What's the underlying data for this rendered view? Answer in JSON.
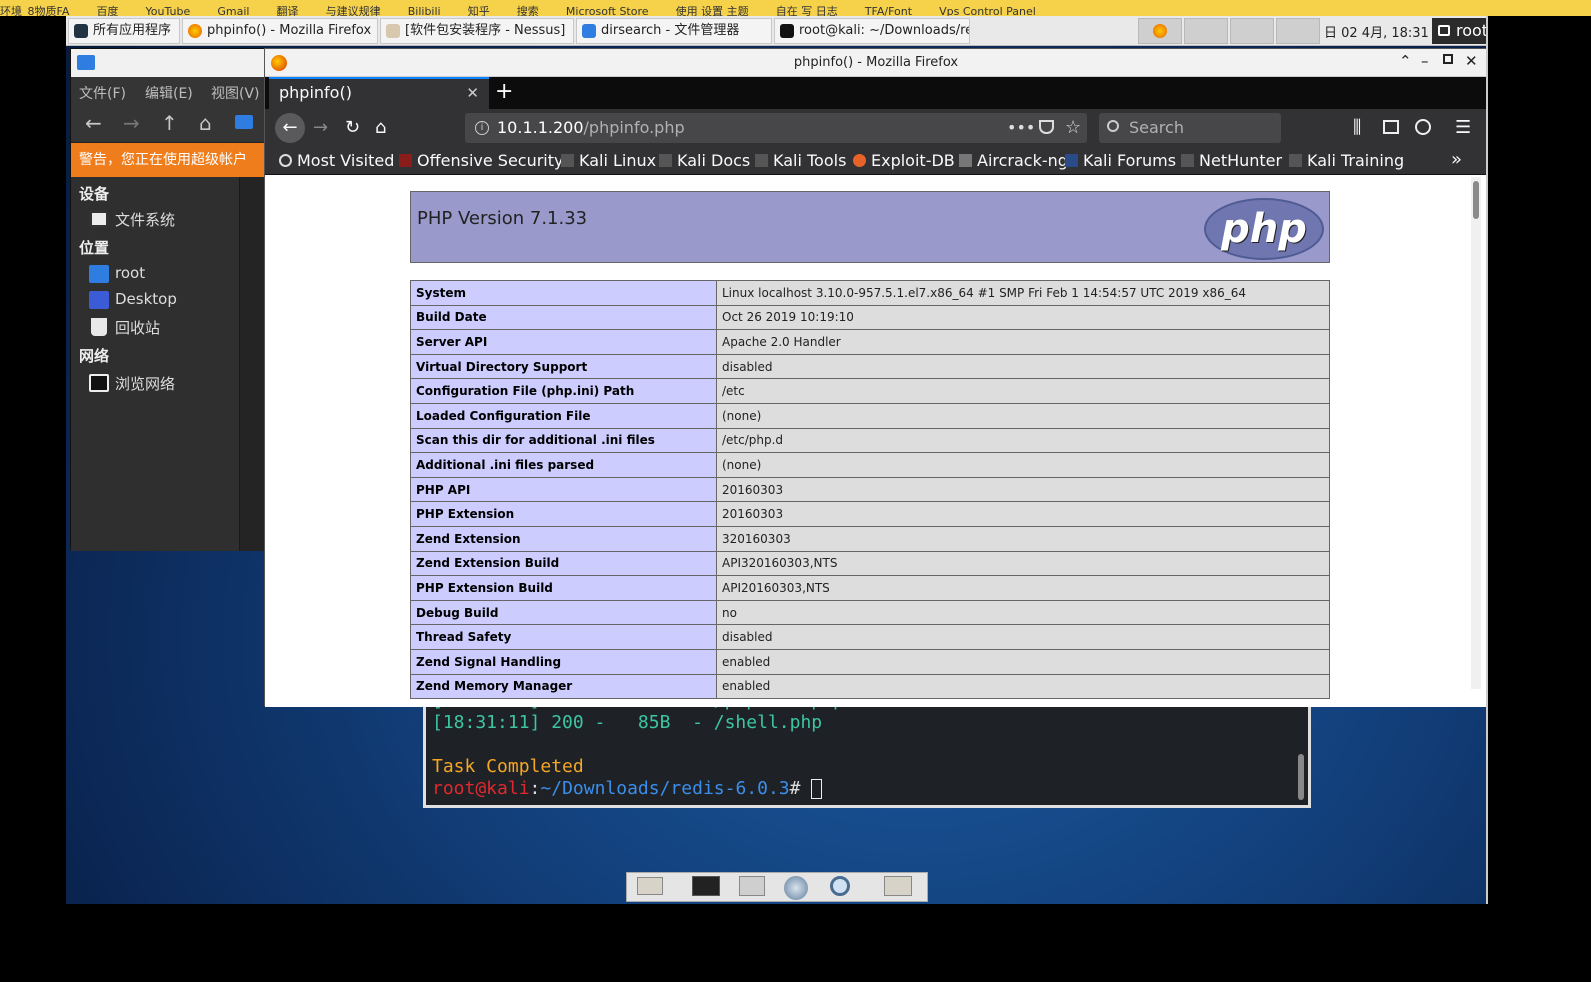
{
  "host_bar": {
    "items": [
      "环境_8物质FA",
      "百度",
      "YouTube",
      "Gmail",
      "翻译",
      "与建议规律",
      "Bilibili",
      "知乎",
      "搜索",
      "Microsoft Store",
      "使用 设置 主题",
      "自在 写 日志",
      "TFA/Font",
      "Vps Control Panel"
    ]
  },
  "taskbar": {
    "apps_label": "所有应用程序",
    "windows": [
      {
        "label": "phpinfo() - Mozilla Firefox",
        "icon": "firefox-icon"
      },
      {
        "label": "[软件包安装程序 - Nessus]",
        "icon": "package-icon"
      },
      {
        "label": "dirsearch - 文件管理器",
        "icon": "folder-icon"
      },
      {
        "label": "root@kali: ~/Downloads/re…",
        "icon": "terminal-icon"
      }
    ],
    "clock": "日 02 4月, 18:31",
    "user": "root"
  },
  "file_manager": {
    "menu": [
      "文件(F)",
      "编辑(E)",
      "视图(V)"
    ],
    "warning": "警告，您正在使用超级帐户",
    "sections": [
      {
        "heading": "设备",
        "items": [
          {
            "label": "文件系统",
            "icon": "drive-icon"
          }
        ]
      },
      {
        "heading": "位置",
        "items": [
          {
            "label": "root",
            "icon": "home-folder-icon"
          },
          {
            "label": "Desktop",
            "icon": "desktop-folder-icon"
          },
          {
            "label": "回收站",
            "icon": "trash-icon"
          }
        ]
      },
      {
        "heading": "网络",
        "items": [
          {
            "label": "浏览网络",
            "icon": "network-icon"
          }
        ]
      }
    ]
  },
  "firefox": {
    "window_title": "phpinfo() - Mozilla Firefox",
    "tab_title": "phpinfo()",
    "url_host": "10.1.1.200",
    "url_path": "/phpinfo.php",
    "search_placeholder": "Search",
    "bookmarks": [
      "Most Visited",
      "Offensive Security",
      "Kali Linux",
      "Kali Docs",
      "Kali Tools",
      "Exploit-DB",
      "Aircrack-ng",
      "Kali Forums",
      "NetHunter",
      "Kali Training"
    ]
  },
  "phpinfo": {
    "version_title": "PHP Version 7.1.33",
    "logo_text": "php",
    "rows": [
      [
        "System",
        "Linux localhost 3.10.0-957.5.1.el7.x86_64 #1 SMP Fri Feb 1 14:54:57 UTC 2019 x86_64"
      ],
      [
        "Build Date",
        "Oct 26 2019 10:19:10"
      ],
      [
        "Server API",
        "Apache 2.0 Handler"
      ],
      [
        "Virtual Directory Support",
        "disabled"
      ],
      [
        "Configuration File (php.ini) Path",
        "/etc"
      ],
      [
        "Loaded Configuration File",
        "(none)"
      ],
      [
        "Scan this dir for additional .ini files",
        "/etc/php.d"
      ],
      [
        "Additional .ini files parsed",
        "(none)"
      ],
      [
        "PHP API",
        "20160303"
      ],
      [
        "PHP Extension",
        "20160303"
      ],
      [
        "Zend Extension",
        "320160303"
      ],
      [
        "Zend Extension Build",
        "API320160303,NTS"
      ],
      [
        "PHP Extension Build",
        "API20160303,NTS"
      ],
      [
        "Debug Build",
        "no"
      ],
      [
        "Thread Safety",
        "disabled"
      ],
      [
        "Zend Signal Handling",
        "enabled"
      ],
      [
        "Zend Memory Manager",
        "enabled"
      ]
    ]
  },
  "terminal": {
    "lines": [
      "[18:31:11] 200 -   56KB - /phpinfo.php",
      "[18:31:11] 200 -   85B  - /shell.php"
    ],
    "status": "Task Completed",
    "prompt_user": "root@kali",
    "prompt_path": "~/Downloads/redis-6.0.3",
    "prompt_symbol": "#"
  },
  "colors": {
    "php_header": "#9999cc",
    "php_key": "#ccccff",
    "php_value": "#dddddd",
    "warning": "#f07d1c",
    "terminal_green": "#3cc5a3",
    "terminal_orange": "#f5a623",
    "prompt_red": "#e0282e",
    "prompt_blue": "#3b8eea"
  }
}
